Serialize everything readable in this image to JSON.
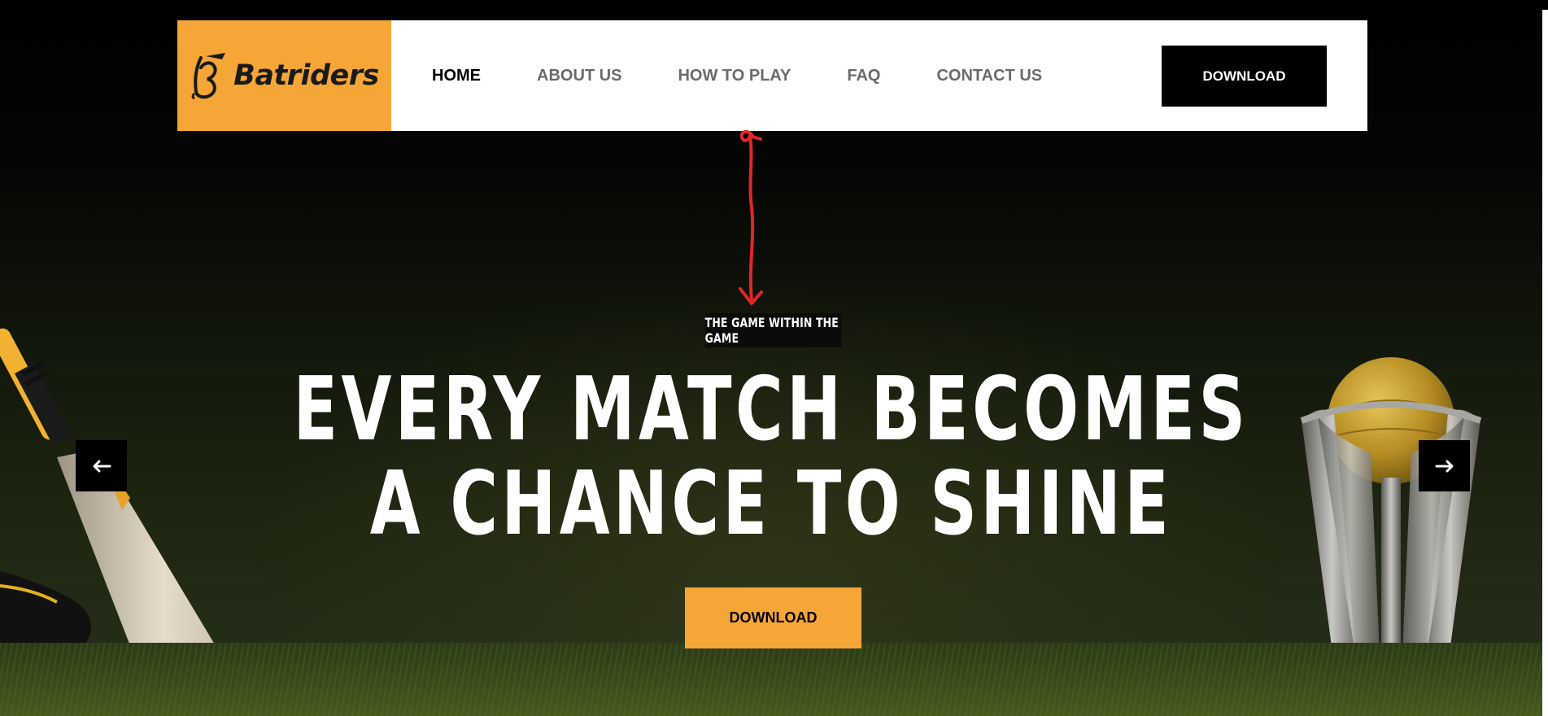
{
  "brand": {
    "name": "Batriders",
    "accent_color": "#f6a637"
  },
  "nav": {
    "items": [
      {
        "label": "HOME",
        "active": true
      },
      {
        "label": "ABOUT US",
        "active": false
      },
      {
        "label": "HOW TO PLAY",
        "active": false
      },
      {
        "label": "FAQ",
        "active": false
      },
      {
        "label": "CONTACT US",
        "active": false
      }
    ],
    "download_label": "DOWNLOAD"
  },
  "hero": {
    "tagline": "THE GAME WITHIN THE GAME",
    "headline_line1": "EVERY MATCH BECOMES",
    "headline_line2": "A CHANCE TO SHINE",
    "download_label": "DOWNLOAD",
    "prev_icon": "arrow-left-icon",
    "next_icon": "arrow-right-icon"
  },
  "annotation": {
    "icon": "double-arrow-annotation-icon",
    "color": "#e0262a"
  }
}
